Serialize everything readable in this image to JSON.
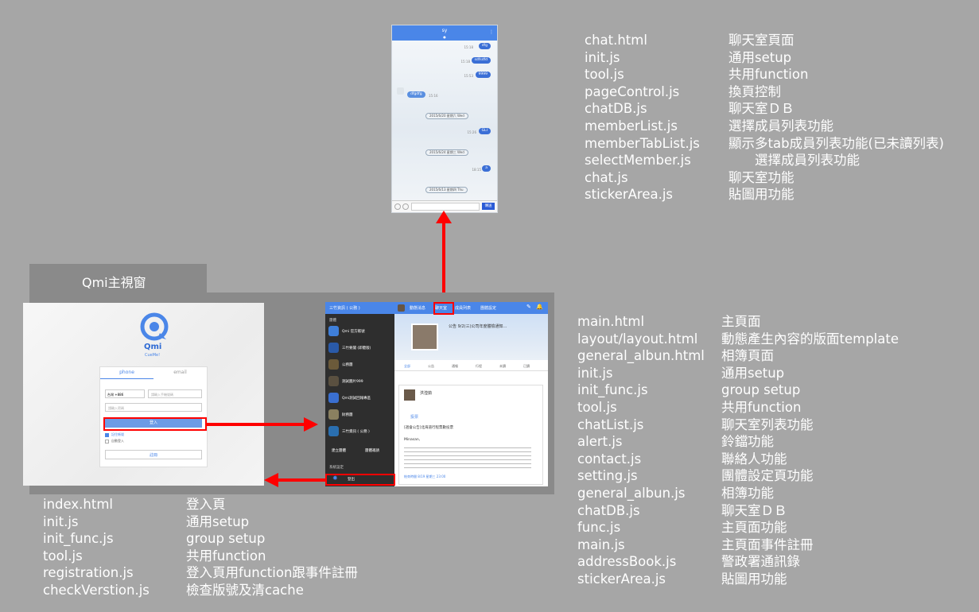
{
  "chat_lists": {
    "chat": [
      [
        "chat.html",
        "聊天室頁面"
      ],
      [
        "init.js",
        "通用setup"
      ],
      [
        "tool.js",
        "共用function"
      ],
      [
        "pageControl.js",
        "換頁控制"
      ],
      [
        "chatDB.js",
        "聊天室ＤＢ"
      ],
      [
        "memberList.js",
        "選擇成員列表功能"
      ],
      [
        "memberTabList.js",
        "顯示多tab成員列表功能(已未讀列表)"
      ],
      [
        "selectMember.js",
        "　　選擇成員列表功能"
      ],
      [
        "chat.js",
        "聊天室功能"
      ],
      [
        "stickerArea.js",
        "貼圖用功能"
      ]
    ],
    "main": [
      [
        "main.html",
        "主頁面"
      ],
      [
        "layout/layout.html",
        "動態產生內容的版面template"
      ],
      [
        "general_albun.html",
        "相簿頁面"
      ],
      [
        "init.js",
        "通用setup"
      ],
      [
        "init_func.js",
        "group setup"
      ],
      [
        "tool.js",
        "共用function"
      ],
      [
        "chatList.js",
        "聊天室列表功能"
      ],
      [
        "alert.js",
        "鈴鐺功能"
      ],
      [
        "contact.js",
        "聯絡人功能"
      ],
      [
        "setting.js",
        "團體設定頁功能"
      ],
      [
        "general_albun.js",
        "相簿功能"
      ],
      [
        "chatDB.js",
        "聊天室ＤＢ"
      ],
      [
        "func.js",
        "主頁面功能"
      ],
      [
        "main.js",
        "主頁面事件註冊"
      ],
      [
        "addressBook.js",
        "警政署通訊錄"
      ],
      [
        "stickerArea.js",
        "貼圖用功能"
      ]
    ],
    "login": [
      [
        "index.html",
        "登入頁"
      ],
      [
        "init.js",
        "通用setup"
      ],
      [
        "init_func.js",
        "group setup"
      ],
      [
        "tool.js",
        "共用function"
      ],
      [
        "registration.js",
        "登入頁用function跟事件註冊"
      ],
      [
        "checkVerstion.js",
        "檢查版號及清cache"
      ]
    ]
  },
  "panel": {
    "title": "Qmi主視窗"
  },
  "phone": {
    "title": "sy",
    "messages": [
      "dfg",
      "sdfsdfd",
      "9999",
      "dfgdfg",
      "GLI",
      "a"
    ],
    "times": [
      "15:18",
      "15:18",
      "15:53",
      "15:16",
      "15:26",
      "18:15"
    ],
    "dates": [
      "2015/6/20 星期六 Wed",
      "2015/6/24 星期三 Wed",
      "2015/6/13 星期四 Thu"
    ],
    "send_label": "傳送"
  },
  "login": {
    "logo_text": "Qmi",
    "logo_sub": "CueMe!",
    "tab_phone": "phone",
    "tab_email": "email",
    "country": "台灣 +886",
    "phone_placeholder": "請輸入手機號碼",
    "password_placeholder": "請輸入密碼",
    "login_button": "登入",
    "remember": "記住帳號",
    "auto_login": "自動登入",
    "register_button": "註冊"
  },
  "mainwin": {
    "group_title": "三竹資訊 ( 公務 )",
    "tabs": [
      "動態消息",
      "聊天室",
      "成員列表",
      "團體設定"
    ],
    "section_group": "團體",
    "groups": [
      "Qmi 官方帳號",
      "三竹要聞 (即聽版)",
      "公務團",
      "測試圖片999",
      "Qmi測試回報專區",
      "財務團",
      "三竹資訊 ( 公務 )"
    ],
    "create_group": "建立團體",
    "group_invite": "團體邀請",
    "section_settings": "系統設定",
    "logout": "登出",
    "subtabs": [
      "全部",
      "公告",
      "通報",
      "行程",
      "未讀",
      "已讀"
    ],
    "notice_title": "公告 9/2(三)公司年度體檢通知…",
    "poster_name": "洪瀅茹",
    "vote_label": "投票",
    "post_heading": "[週會公告]北海道行程票數投票",
    "post_greeting": "Minasan,",
    "post_foot": "結束時間 8/19 星期三 23:00"
  }
}
